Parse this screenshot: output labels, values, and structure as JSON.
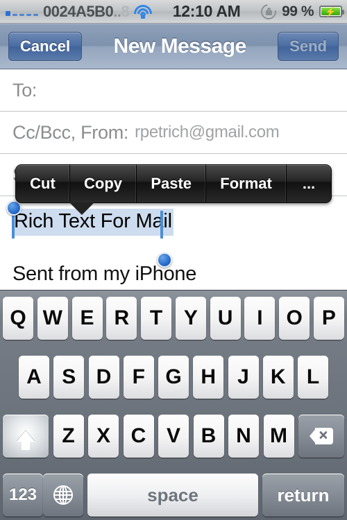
{
  "status_bar": {
    "signal_icon": "signal-bars-icon",
    "carrier": "0024A5B0",
    "carrier_fade1": "..",
    "carrier_fade2": "8",
    "wifi_icon": "wifi-icon",
    "time": "12:10 AM",
    "rotation_lock_icon": "rotation-lock-icon",
    "battery_percent": "99 %",
    "battery_icon": "battery-charging-icon",
    "battery_color": "#55c01c"
  },
  "nav_bar": {
    "cancel_label": "Cancel",
    "title": "New Message",
    "send_label": "Send",
    "accent_color": "#4a6da3"
  },
  "compose": {
    "to_label": "To:",
    "to_value": "",
    "cc_label": "Cc/Bcc, From:",
    "cc_value": "rpetrich@gmail.com",
    "subject_label": "Subject:",
    "subject_value": "",
    "selected_text": "Rich Text For Mail",
    "signature": "Sent from my iPhone",
    "selection_color": "#cddcee",
    "handle_color": "#1d63c9"
  },
  "edit_menu": {
    "items": [
      {
        "label": "Cut"
      },
      {
        "label": "Copy"
      },
      {
        "label": "Paste"
      },
      {
        "label": "Format"
      },
      {
        "label": "..."
      }
    ]
  },
  "keyboard": {
    "row1": [
      "Q",
      "W",
      "E",
      "R",
      "T",
      "Y",
      "U",
      "I",
      "O",
      "P"
    ],
    "row2": [
      "A",
      "S",
      "D",
      "F",
      "G",
      "H",
      "J",
      "K",
      "L"
    ],
    "row3": [
      "Z",
      "X",
      "C",
      "V",
      "B",
      "N",
      "M"
    ],
    "shift_icon": "shift-arrow-icon",
    "backspace_icon": "backspace-icon",
    "numbers_label": "123",
    "globe_icon": "globe-icon",
    "space_label": "space",
    "return_label": "return"
  }
}
